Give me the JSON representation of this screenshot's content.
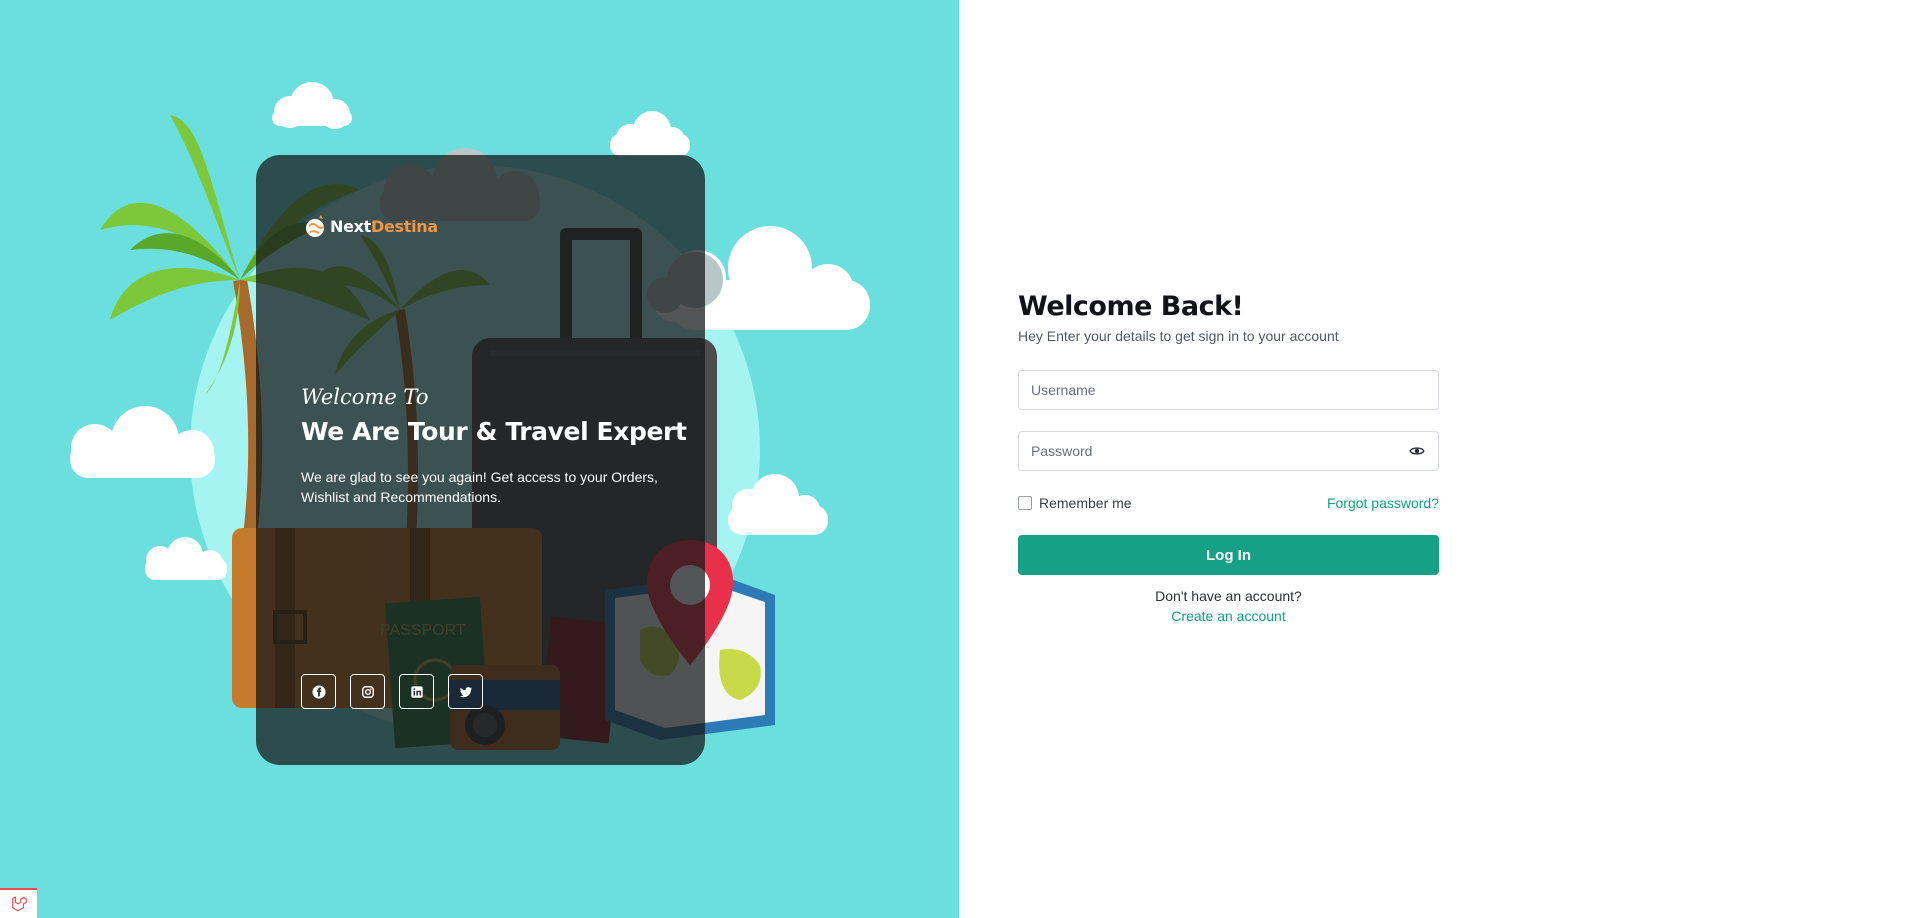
{
  "brand": {
    "name_part1": "Next",
    "name_part2": "Destina",
    "accent_color": "#f4953f"
  },
  "hero": {
    "script_heading": "Welcome To",
    "title": "We Are Tour & Travel Expert",
    "description": "We are glad to see you again! Get access to your Orders, Wishlist and Recommendations."
  },
  "socials": [
    {
      "name": "facebook",
      "icon": "facebook-icon"
    },
    {
      "name": "instagram",
      "icon": "instagram-icon"
    },
    {
      "name": "linkedin",
      "icon": "linkedin-icon"
    },
    {
      "name": "twitter",
      "icon": "twitter-icon"
    }
  ],
  "login": {
    "title": "Welcome Back!",
    "subtitle": "Hey Enter your details to get sign in to your account",
    "username_placeholder": "Username",
    "username_value": "",
    "password_placeholder": "Password",
    "password_value": "",
    "remember_label": "Remember me",
    "remember_checked": false,
    "forgot_label": "Forgot password?",
    "submit_label": "Log In",
    "no_account_text": "Don't have an account?",
    "create_account_label": "Create an account"
  },
  "colors": {
    "left_background": "#6bdede",
    "primary": "#16a085",
    "card_overlay": "rgba(22,24,26,0.74)"
  },
  "icons": {
    "password_toggle": "eye-icon",
    "corner_badge": "laravel-icon"
  }
}
